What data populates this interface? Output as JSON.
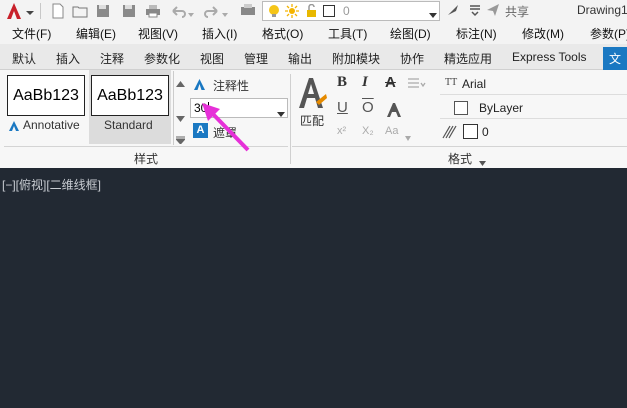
{
  "qat": {
    "layer_value": "0",
    "share_label": "共享",
    "title": "Drawing1"
  },
  "menubar": {
    "items": [
      "文件(F)",
      "编辑(E)",
      "视图(V)",
      "插入(I)",
      "格式(O)",
      "工具(T)",
      "绘图(D)",
      "标注(N)",
      "修改(M)",
      "参数(P)"
    ]
  },
  "ribbon_tabs": {
    "items": [
      "默认",
      "插入",
      "注释",
      "参数化",
      "视图",
      "管理",
      "输出",
      "附加模块",
      "协作",
      "精选应用",
      "Express Tools"
    ],
    "active": "文"
  },
  "style_panel": {
    "style1_preview": "AaBb123",
    "style1_name": "Annotative",
    "style2_preview": "AaBb123",
    "style2_name": "Standard",
    "annotative_label": "注释性",
    "height_value": "30",
    "mask_label": "遮罩",
    "title": "样式"
  },
  "format_panel": {
    "match_label": "匹配",
    "bold": "B",
    "italic": "I",
    "strike": "A",
    "underline": "U",
    "overline": "O",
    "superscript": "x²",
    "subscript": "X₂",
    "case": "Aa",
    "font_value": "Arial",
    "color_value": "ByLayer",
    "oblique_value": "0",
    "title": "格式"
  },
  "viewport": {
    "label": "[−][俯视][二维线框]"
  },
  "colors": {
    "accent": "#1a78c2",
    "canvas": "#222933",
    "arrow": "#e630d8",
    "logo": "#c8202a"
  }
}
